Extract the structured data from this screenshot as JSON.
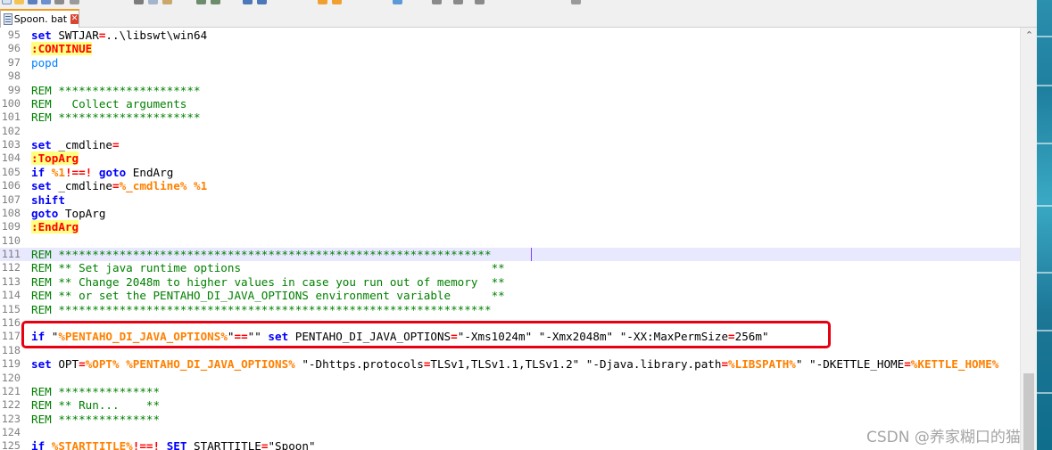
{
  "tab": {
    "label": "Spoon. bat",
    "close_glyph": "✕"
  },
  "watermark": "CSDN @养家糊口的猫",
  "scrollbar": {
    "up_glyph": "⌃"
  },
  "lines": [
    {
      "num": "95",
      "tokens": [
        [
          "kw",
          "set"
        ],
        [
          "t",
          " SWTJAR"
        ],
        [
          "op",
          "="
        ],
        [
          "t",
          "..\\libswt\\win64"
        ]
      ]
    },
    {
      "num": "96",
      "tokens": [
        [
          "label",
          ":CONTINUE"
        ]
      ]
    },
    {
      "num": "97",
      "tokens": [
        [
          "pop",
          "popd"
        ]
      ]
    },
    {
      "num": "98",
      "tokens": []
    },
    {
      "num": "99",
      "tokens": [
        [
          "rem",
          "REM *********************"
        ]
      ]
    },
    {
      "num": "100",
      "tokens": [
        [
          "rem",
          "REM   Collect arguments"
        ]
      ]
    },
    {
      "num": "101",
      "tokens": [
        [
          "rem",
          "REM *********************"
        ]
      ]
    },
    {
      "num": "102",
      "tokens": []
    },
    {
      "num": "103",
      "tokens": [
        [
          "kw",
          "set"
        ],
        [
          "t",
          " _cmdline"
        ],
        [
          "op",
          "="
        ]
      ]
    },
    {
      "num": "104",
      "tokens": [
        [
          "label",
          ":TopArg"
        ]
      ]
    },
    {
      "num": "105",
      "tokens": [
        [
          "kw",
          "if"
        ],
        [
          "t",
          " "
        ],
        [
          "var",
          "%1"
        ],
        [
          "op",
          "!==!"
        ],
        [
          "t",
          " "
        ],
        [
          "kw",
          "goto"
        ],
        [
          "t",
          " EndArg"
        ]
      ]
    },
    {
      "num": "106",
      "tokens": [
        [
          "kw",
          "set"
        ],
        [
          "t",
          " _cmdline"
        ],
        [
          "op",
          "="
        ],
        [
          "var",
          "%_cmdline%"
        ],
        [
          "t",
          " "
        ],
        [
          "var",
          "%1"
        ]
      ]
    },
    {
      "num": "107",
      "tokens": [
        [
          "kw",
          "shift"
        ]
      ]
    },
    {
      "num": "108",
      "tokens": [
        [
          "kw",
          "goto"
        ],
        [
          "t",
          " TopArg"
        ]
      ]
    },
    {
      "num": "109",
      "tokens": [
        [
          "label",
          ":EndArg"
        ]
      ]
    },
    {
      "num": "110",
      "tokens": []
    },
    {
      "num": "111",
      "caret": true,
      "tokens": [
        [
          "rem",
          "REM ****************************************************************"
        ]
      ]
    },
    {
      "num": "112",
      "tokens": [
        [
          "rem",
          "REM ** Set java runtime options                                     **"
        ]
      ]
    },
    {
      "num": "113",
      "tokens": [
        [
          "rem",
          "REM ** Change 2048m to higher values in case you run out of memory  **"
        ]
      ]
    },
    {
      "num": "114",
      "tokens": [
        [
          "rem",
          "REM ** or set the PENTAHO_DI_JAVA_OPTIONS environment variable      **"
        ]
      ]
    },
    {
      "num": "115",
      "tokens": [
        [
          "rem",
          "REM ****************************************************************"
        ]
      ]
    },
    {
      "num": "116",
      "tokens": []
    },
    {
      "num": "117",
      "tokens": [
        [
          "kw",
          "if"
        ],
        [
          "t",
          " \""
        ],
        [
          "var",
          "%PENTAHO_DI_JAVA_OPTIONS%"
        ],
        [
          "t",
          "\""
        ],
        [
          "op",
          "=="
        ],
        [
          "t",
          "\"\" "
        ],
        [
          "kw",
          "set"
        ],
        [
          "t",
          " PENTAHO_DI_JAVA_OPTIONS"
        ],
        [
          "op",
          "="
        ],
        [
          "t",
          "\"-Xms1024m\" \"-Xmx2048m\" \"-XX:MaxPermSize"
        ],
        [
          "op",
          "="
        ],
        [
          "t",
          "256m\""
        ]
      ]
    },
    {
      "num": "118",
      "tokens": []
    },
    {
      "num": "119",
      "tokens": [
        [
          "kw",
          "set"
        ],
        [
          "t",
          " OPT"
        ],
        [
          "op",
          "="
        ],
        [
          "var",
          "%OPT%"
        ],
        [
          "t",
          " "
        ],
        [
          "var",
          "%PENTAHO_DI_JAVA_OPTIONS%"
        ],
        [
          "t",
          " \"-Dhttps.protocols"
        ],
        [
          "op",
          "="
        ],
        [
          "t",
          "TLSv1,TLSv1.1,TLSv1.2\" \"-Djava.library.path"
        ],
        [
          "op",
          "="
        ],
        [
          "var",
          "%LIBSPATH%"
        ],
        [
          "t",
          "\" \"-DKETTLE_HOME"
        ],
        [
          "op",
          "="
        ],
        [
          "var",
          "%KETTLE_HOME%"
        ]
      ]
    },
    {
      "num": "120",
      "tokens": []
    },
    {
      "num": "121",
      "tokens": [
        [
          "rem",
          "REM ***************"
        ]
      ]
    },
    {
      "num": "122",
      "tokens": [
        [
          "rem",
          "REM ** Run...    **"
        ]
      ]
    },
    {
      "num": "123",
      "tokens": [
        [
          "rem",
          "REM ***************"
        ]
      ]
    },
    {
      "num": "124",
      "tokens": []
    },
    {
      "num": "125",
      "tokens": [
        [
          "kw",
          "if"
        ],
        [
          "t",
          " "
        ],
        [
          "var",
          "%STARTTITLE%"
        ],
        [
          "op",
          "!==!"
        ],
        [
          "t",
          " "
        ],
        [
          "kw",
          "SET"
        ],
        [
          "t",
          " STARTTITLE"
        ],
        [
          "op",
          "="
        ],
        [
          "t",
          "\"Spoon\""
        ]
      ]
    }
  ]
}
